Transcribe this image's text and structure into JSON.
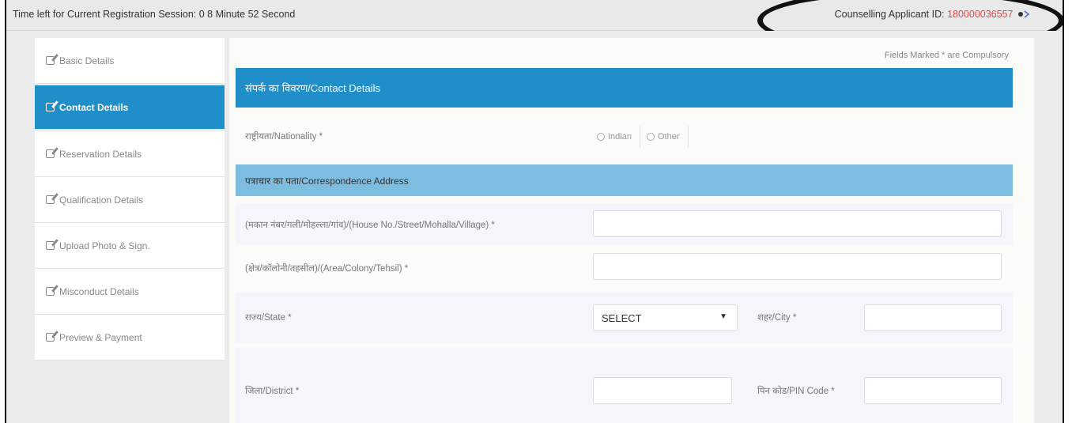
{
  "topbar": {
    "session_text": "Time left for Current Registration Session: 0 8 Minute 52 Second",
    "applicant_label": "Counselling Applicant ID: ",
    "applicant_id": "180000036557",
    "exit_icon": "logout-icon"
  },
  "sidebar": {
    "items": [
      {
        "label": "Basic Details",
        "icon": "edit-icon"
      },
      {
        "label": "Contact Details",
        "icon": "edit-icon"
      },
      {
        "label": "Reservation Details",
        "icon": "edit-icon"
      },
      {
        "label": "Qualification Details",
        "icon": "edit-icon"
      },
      {
        "label": "Upload Photo & Sign.",
        "icon": "edit-icon"
      },
      {
        "label": "Misconduct Details",
        "icon": "edit-icon"
      },
      {
        "label": "Preview & Payment",
        "icon": "edit-icon"
      }
    ],
    "active_index": 1
  },
  "main": {
    "mandatory_note": "Fields Marked * are Compulsory",
    "section_title": "संपर्क का विवरण/Contact Details",
    "nationality": {
      "label": "राष्ट्रीयता/Nationality *",
      "options": [
        "Indian",
        "Other"
      ]
    },
    "address_title": "पत्राचार का पता/Correspondence Address",
    "house_label": "(मकान नंबर/गली/मोहल्ला/गांव)/(House No./Street/Mohalla/Village) *",
    "area_label": "(क्षेत्र/कॉलोनी/तहसील)/(Area/Colony/Tehsil) *",
    "state_label": "राज्य/State *",
    "state_value": "SELECT",
    "city_label": "शहर/City *",
    "district_label": "जिला/District *",
    "pincode_label": "पिन कोड/PIN Code *"
  },
  "colors": {
    "primary": "#1f8ec9",
    "subheader": "#7dbde0",
    "applicant_id": "#e04848"
  }
}
